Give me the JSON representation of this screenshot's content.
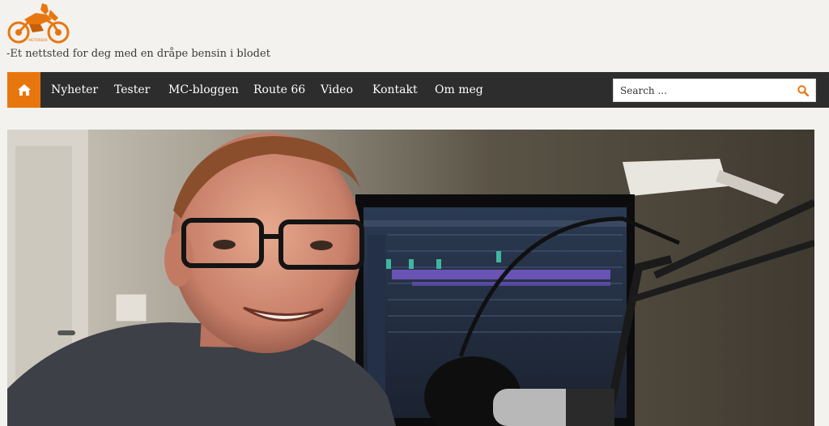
{
  "site": {
    "logo_text": "MOTORBOX",
    "tagline": "-Et nettsted for deg med en dråpe bensin i blodet"
  },
  "nav": {
    "home_icon": "home-icon",
    "items": [
      {
        "label": "Nyheter"
      },
      {
        "label": "Tester"
      },
      {
        "label": "MC-bloggen"
      },
      {
        "label": "Route 66"
      },
      {
        "label": "Video"
      },
      {
        "label": "Kontakt"
      },
      {
        "label": "Om meg"
      }
    ]
  },
  "search": {
    "placeholder": "Search ...",
    "icon": "search-icon"
  },
  "colors": {
    "accent": "#e8760f",
    "navbar": "#2d2d2d",
    "background": "#f3f2ef"
  },
  "hero": {
    "alt": "Smiling man with glasses in a home studio with a microphone and a computer monitor"
  }
}
